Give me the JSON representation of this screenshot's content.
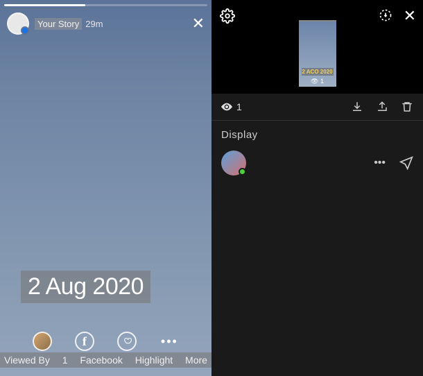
{
  "left": {
    "story_label": "Your Story",
    "time": "29m",
    "date_text": "2 Aug 2020",
    "footer": {
      "viewed_by": "Viewed By",
      "count": "1",
      "facebook": "Facebook",
      "highlight": "Highlight",
      "more": "More"
    }
  },
  "right": {
    "thumb_date": "2 ACO 2020",
    "thumb_views": "👁 1",
    "view_count": "1",
    "section_label": "Display"
  }
}
